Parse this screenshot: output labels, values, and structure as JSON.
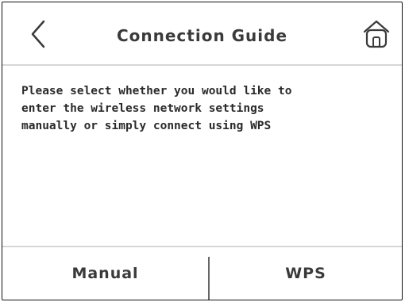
{
  "header": {
    "title": "Connection Guide",
    "back_icon": "chevron-left-icon",
    "home_icon": "home-icon"
  },
  "message": {
    "line1": "Please select whether you would like to",
    "line2": "enter the wireless network settings",
    "line3": "manually or simply connect using WPS"
  },
  "footer": {
    "manual_label": "Manual",
    "wps_label": "WPS"
  },
  "colors": {
    "text": "#3a3a3a",
    "divider": "#d7d7d7",
    "border": "#111111"
  }
}
